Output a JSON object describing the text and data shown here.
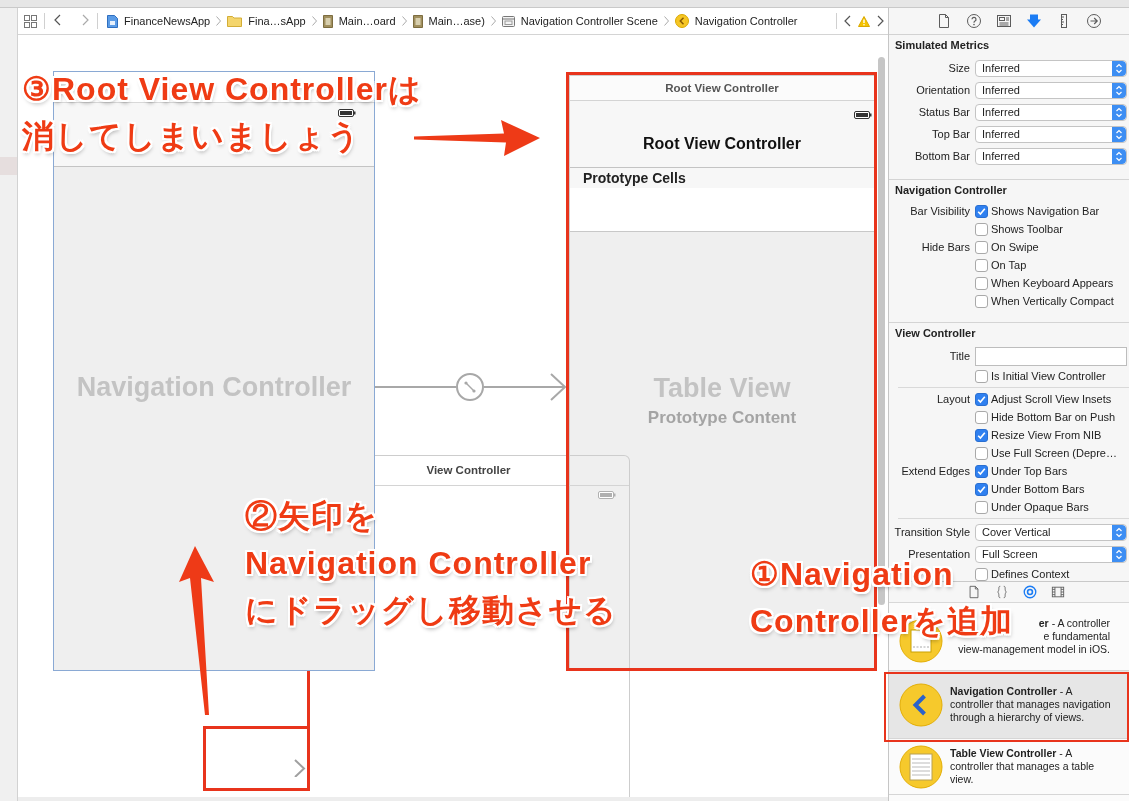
{
  "jump_bar": {
    "items": [
      {
        "kind": "project",
        "label": "FinanceNewsApp"
      },
      {
        "kind": "folder",
        "label": "Fina…sApp"
      },
      {
        "kind": "storyboard",
        "label": "Main…oard"
      },
      {
        "kind": "storyboard",
        "label": "Main…ase)"
      },
      {
        "kind": "scene",
        "label": "Navigation Controller Scene"
      },
      {
        "kind": "controller",
        "label": "Navigation Controller"
      }
    ]
  },
  "canvas": {
    "navigation_scene": {
      "label": "Navigation Controller"
    },
    "root_scene": {
      "title": "Root View Controller",
      "nav_title": "Root View Controller",
      "section_header": "Prototype Cells",
      "label": "Table View",
      "sublabel": "Prototype Content"
    },
    "view_controller_scene": {
      "title": "View Controller"
    }
  },
  "inspector": {
    "tabs": [
      {
        "kind": "file",
        "selected": false
      },
      {
        "kind": "help",
        "selected": false
      },
      {
        "kind": "identity",
        "selected": false
      },
      {
        "kind": "attributes",
        "selected": true
      },
      {
        "kind": "size",
        "selected": false
      },
      {
        "kind": "connections",
        "selected": false
      }
    ],
    "sections": [
      {
        "title": "Simulated Metrics",
        "groups": [
          [
            {
              "kind": "popup",
              "label": "Size",
              "value": "Inferred"
            },
            {
              "kind": "popup",
              "label": "Orientation",
              "value": "Inferred"
            },
            {
              "kind": "popup",
              "label": "Status Bar",
              "value": "Inferred"
            },
            {
              "kind": "popup",
              "label": "Top Bar",
              "value": "Inferred"
            },
            {
              "kind": "popup",
              "label": "Bottom Bar",
              "value": "Inferred"
            }
          ]
        ]
      },
      {
        "title": "Navigation Controller",
        "groups": [
          [
            {
              "kind": "check",
              "label": "Bar Visibility",
              "text": "Shows Navigation Bar",
              "checked": true
            },
            {
              "kind": "check",
              "text": "Shows Toolbar",
              "checked": false
            },
            {
              "kind": "check",
              "label": "Hide Bars",
              "text": "On Swipe",
              "checked": false
            },
            {
              "kind": "check",
              "text": "On Tap",
              "checked": false
            },
            {
              "kind": "check",
              "text": "When Keyboard Appears",
              "checked": false
            },
            {
              "kind": "check",
              "text": "When Vertically Compact",
              "checked": false
            }
          ]
        ]
      },
      {
        "title": "View Controller",
        "groups": [
          [
            {
              "kind": "field",
              "label": "Title"
            },
            {
              "kind": "check",
              "text": "Is Initial View Controller",
              "checked": false
            }
          ],
          [
            {
              "kind": "check",
              "label": "Layout",
              "text": "Adjust Scroll View Insets",
              "checked": true
            },
            {
              "kind": "check",
              "text": "Hide Bottom Bar on Push",
              "checked": false
            },
            {
              "kind": "check",
              "text": "Resize View From NIB",
              "checked": true
            },
            {
              "kind": "check",
              "text": "Use Full Screen (Depre…",
              "checked": false
            },
            {
              "kind": "check",
              "label": "Extend Edges",
              "text": "Under Top Bars",
              "checked": true
            },
            {
              "kind": "check",
              "text": "Under Bottom Bars",
              "checked": true
            },
            {
              "kind": "check",
              "text": "Under Opaque Bars",
              "checked": false
            }
          ],
          [
            {
              "kind": "popup",
              "label": "Transition Style",
              "value": "Cover Vertical"
            },
            {
              "kind": "popup",
              "label": "Presentation",
              "value": "Full Screen"
            },
            {
              "kind": "check",
              "text": "Defines Context",
              "checked": false
            }
          ]
        ]
      }
    ]
  },
  "library": {
    "tabs": [
      {
        "kind": "file",
        "selected": false
      },
      {
        "kind": "code",
        "selected": false
      },
      {
        "kind": "objects",
        "selected": true
      },
      {
        "kind": "media",
        "selected": false
      }
    ],
    "items": [
      {
        "kind": "view_controller",
        "partly_covered": true,
        "selected": false,
        "lines": [
          "**er** - A controller",
          "e fundamental",
          "view-management model in iOS."
        ]
      },
      {
        "kind": "navigation_controller",
        "partly_covered": false,
        "selected": true,
        "lines": [
          "**Navigation Controller** - A",
          "controller that manages navigation",
          "through a hierarchy of views."
        ]
      },
      {
        "kind": "table_view_controller",
        "partly_covered": false,
        "selected": false,
        "lines": [
          "**Table View Controller** - A",
          "controller that manages a table",
          "view."
        ]
      }
    ]
  },
  "annotations": [
    {
      "lines": [
        "③Root View Controllerは",
        "消してしまいましょう"
      ]
    },
    {
      "lines": [
        "②矢印を",
        "Navigation Controller",
        "にドラッグし移動させる"
      ]
    },
    {
      "lines": [
        "①Navigation",
        "Controllerを追加"
      ]
    }
  ]
}
